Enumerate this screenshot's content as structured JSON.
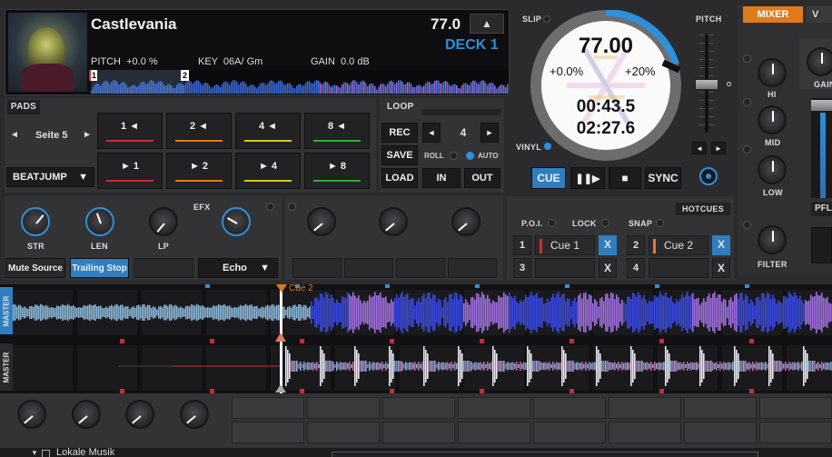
{
  "deck": {
    "title": "Castlevania",
    "bpm": "77.0",
    "name": "DECK 1",
    "pitch": "PITCH  +0.0 %",
    "key": "KEY  06A/ Gm",
    "gain": "GAIN  0.0 dB",
    "marker1": "1",
    "marker2": "2"
  },
  "jog": {
    "bpm": "77.00",
    "pitch_left": "+0.0%",
    "pitch_right": "+20%",
    "elapsed": "00:43.5",
    "remaining": "02:27.6",
    "slip_label": "SLIP",
    "vinyl_label": "VINYL"
  },
  "pitch": {
    "label": "PITCH"
  },
  "transport": {
    "cue": "CUE",
    "sync": "SYNC"
  },
  "mixer": {
    "tab_mixer": "MIXER",
    "tab_v": "V",
    "labels": {
      "gain": "GAIN",
      "hi": "HI",
      "mid": "MID",
      "low": "LOW",
      "filter": "FILTER",
      "pfl": "PFL"
    }
  },
  "pads": {
    "title": "PADS",
    "page": "Seite 5",
    "mode": "BEATJUMP",
    "buttons": [
      {
        "label": "1",
        "arrow": "◄",
        "pre": false,
        "color": "#d02a2a"
      },
      {
        "label": "1",
        "arrow": "►",
        "pre": true,
        "color": "#d02a2a"
      },
      {
        "label": "2",
        "arrow": "◄",
        "pre": false,
        "color": "#e07a1a"
      },
      {
        "label": "2",
        "arrow": "►",
        "pre": true,
        "color": "#e07a1a"
      },
      {
        "label": "4",
        "arrow": "◄",
        "pre": false,
        "color": "#d8c81a"
      },
      {
        "label": "4",
        "arrow": "►",
        "pre": true,
        "color": "#d8c81a"
      },
      {
        "label": "8",
        "arrow": "◄",
        "pre": false,
        "color": "#2ab02a"
      },
      {
        "label": "8",
        "arrow": "►",
        "pre": true,
        "color": "#2ab02a"
      }
    ]
  },
  "loop": {
    "title": "LOOP",
    "rec": "REC",
    "save": "SAVE",
    "load": "LOAD",
    "size": "4",
    "roll": "ROLL",
    "auto": "AUTO",
    "in": "IN",
    "out": "OUT"
  },
  "efx": {
    "title": "EFX",
    "knobs": [
      "STR",
      "LEN",
      "LP"
    ],
    "mute": "Mute Source",
    "trailing": "Trailing Stop",
    "effect": "Echo"
  },
  "hotcues": {
    "title": "HOTCUES",
    "poi": "P.O.I.",
    "lock": "LOCK",
    "snap": "SNAP",
    "cues": [
      {
        "num": "1",
        "name": "Cue 1",
        "color": "#d02a2a"
      },
      {
        "num": "2",
        "name": "Cue 2",
        "color": "#e07a3a"
      },
      {
        "num": "3",
        "name": ""
      },
      {
        "num": "4",
        "name": ""
      }
    ],
    "x": "X"
  },
  "waveform": {
    "master1": "MASTER",
    "master2": "MASTER",
    "cue_flag": "Cue 2"
  },
  "browser": {
    "folder": "Lokale Musik"
  },
  "colors": {
    "accent": "#2f8fd8",
    "orange": "#e07a1a",
    "panel": "#333336"
  }
}
